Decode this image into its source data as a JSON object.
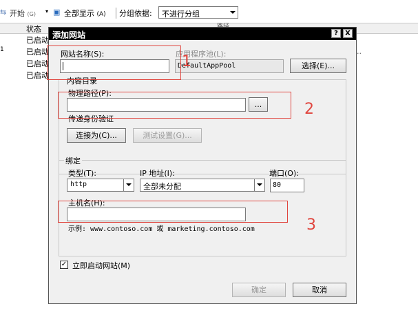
{
  "toolbar": {
    "start_label": "开始",
    "start_shortcut": "(G)",
    "show_all_label": "全部显示",
    "show_all_shortcut": "(A)",
    "group_by_label": "分组依据:",
    "group_by_value": "不进行分组"
  },
  "list": {
    "status_header": "状态",
    "path_header": "路径",
    "row_prefix": "1",
    "status_values": [
      "已启动",
      "已启动",
      "已启动",
      "已启动"
    ],
    "status_truncated": [
      "已启",
      "已启",
      "已启",
      "已启"
    ],
    "trailing": ".."
  },
  "dialog": {
    "title": "添加网站",
    "help_btn": "?",
    "close_btn": "X",
    "site_name_label": "网站名称(S):",
    "site_name_value": "",
    "app_pool_label": "应用程序池(L):",
    "app_pool_value": "DefaultAppPool",
    "select_button": "选择(E)...",
    "content_dir_label": "内容目录",
    "physical_path_label": "物理路径(P):",
    "physical_path_value": "",
    "browse_button": "...",
    "passthrough_label": "传递身份验证",
    "connect_as_button": "连接为(C)...",
    "test_settings_button": "测试设置(G)...",
    "binding_label": "绑定",
    "type_label": "类型(T):",
    "type_value": "http",
    "ip_label": "IP 地址(I):",
    "ip_value": "全部未分配",
    "port_label": "端口(O):",
    "port_value": "80",
    "hostname_label": "主机名(H):",
    "hostname_value": "",
    "example_text": "示例: www.contoso.com 或 marketing.contoso.com",
    "start_now_label": "立即启动网站(M)",
    "start_now_checked": true,
    "ok_button": "确定",
    "cancel_button": "取消"
  },
  "annotations": {
    "n1": "1",
    "n2": "2",
    "n3": "3",
    "color": "#e0453e"
  }
}
